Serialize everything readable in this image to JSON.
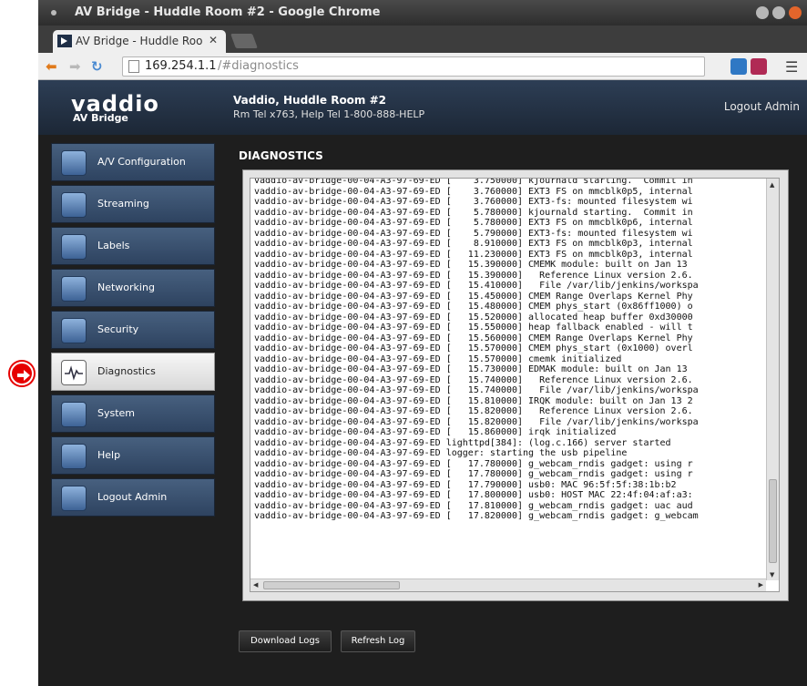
{
  "browser": {
    "window_title": "AV Bridge - Huddle Room #2 - Google Chrome",
    "tab_title": "AV Bridge - Huddle Roo",
    "url_host": "169.254.1.1",
    "url_path": "/#diagnostics"
  },
  "header": {
    "logo": "vaddio",
    "product": "AV Bridge",
    "room_title": "Vaddio, Huddle Room #2",
    "room_phones": "Rm Tel x763, Help Tel 1-800-888-HELP",
    "logout": "Logout Admin"
  },
  "sidebar": {
    "items": [
      {
        "label": "A/V Configuration",
        "icon": "av-config-icon",
        "active": false
      },
      {
        "label": "Streaming",
        "icon": "streaming-icon",
        "active": false
      },
      {
        "label": "Labels",
        "icon": "labels-icon",
        "active": false
      },
      {
        "label": "Networking",
        "icon": "networking-icon",
        "active": false
      },
      {
        "label": "Security",
        "icon": "security-icon",
        "active": false
      },
      {
        "label": "Diagnostics",
        "icon": "diagnostics-icon",
        "active": true
      },
      {
        "label": "System",
        "icon": "system-icon",
        "active": false
      },
      {
        "label": "Help",
        "icon": "help-icon",
        "active": false
      },
      {
        "label": "Logout Admin",
        "icon": "logout-icon",
        "active": false
      }
    ]
  },
  "main": {
    "title": "DIAGNOSTICS",
    "log_lines": [
      "vaddio-av-bridge-00-04-A3-97-69-ED [    3.750000] kjournald starting.  Commit in",
      "vaddio-av-bridge-00-04-A3-97-69-ED [    3.760000] EXT3 FS on mmcblk0p5, internal",
      "vaddio-av-bridge-00-04-A3-97-69-ED [    3.760000] EXT3-fs: mounted filesystem wi",
      "vaddio-av-bridge-00-04-A3-97-69-ED [    5.780000] kjournald starting.  Commit in",
      "vaddio-av-bridge-00-04-A3-97-69-ED [    5.780000] EXT3 FS on mmcblk0p6, internal",
      "vaddio-av-bridge-00-04-A3-97-69-ED [    5.790000] EXT3-fs: mounted filesystem wi",
      "vaddio-av-bridge-00-04-A3-97-69-ED [    8.910000] EXT3 FS on mmcblk0p3, internal",
      "vaddio-av-bridge-00-04-A3-97-69-ED [   11.230000] EXT3 FS on mmcblk0p3, internal",
      "vaddio-av-bridge-00-04-A3-97-69-ED [   15.390000] CMEMK module: built on Jan 13",
      "vaddio-av-bridge-00-04-A3-97-69-ED [   15.390000]   Reference Linux version 2.6.",
      "vaddio-av-bridge-00-04-A3-97-69-ED [   15.410000]   File /var/lib/jenkins/workspa",
      "vaddio-av-bridge-00-04-A3-97-69-ED [   15.450000] CMEM Range Overlaps Kernel Phy",
      "vaddio-av-bridge-00-04-A3-97-69-ED [   15.480000] CMEM phys_start (0x86ff1000) o",
      "vaddio-av-bridge-00-04-A3-97-69-ED [   15.520000] allocated heap buffer 0xd30000",
      "vaddio-av-bridge-00-04-A3-97-69-ED [   15.550000] heap fallback enabled - will t",
      "vaddio-av-bridge-00-04-A3-97-69-ED [   15.560000] CMEM Range Overlaps Kernel Phy",
      "vaddio-av-bridge-00-04-A3-97-69-ED [   15.570000] CMEM phys_start (0x1000) overl",
      "vaddio-av-bridge-00-04-A3-97-69-ED [   15.570000] cmemk initialized",
      "vaddio-av-bridge-00-04-A3-97-69-ED [   15.730000] EDMAK module: built on Jan 13",
      "vaddio-av-bridge-00-04-A3-97-69-ED [   15.740000]   Reference Linux version 2.6.",
      "vaddio-av-bridge-00-04-A3-97-69-ED [   15.740000]   File /var/lib/jenkins/workspa",
      "vaddio-av-bridge-00-04-A3-97-69-ED [   15.810000] IRQK module: built on Jan 13 2",
      "vaddio-av-bridge-00-04-A3-97-69-ED [   15.820000]   Reference Linux version 2.6.",
      "vaddio-av-bridge-00-04-A3-97-69-ED [   15.820000]   File /var/lib/jenkins/workspa",
      "vaddio-av-bridge-00-04-A3-97-69-ED [   15.860000] irqk initialized",
      "vaddio-av-bridge-00-04-A3-97-69-ED lighttpd[384]: (log.c.166) server started",
      "vaddio-av-bridge-00-04-A3-97-69-ED logger: starting the usb pipeline",
      "vaddio-av-bridge-00-04-A3-97-69-ED [   17.780000] g_webcam_rndis gadget: using r",
      "vaddio-av-bridge-00-04-A3-97-69-ED [   17.780000] g_webcam_rndis gadget: using r",
      "vaddio-av-bridge-00-04-A3-97-69-ED [   17.790000] usb0: MAC 96:5f:5f:38:1b:b2",
      "vaddio-av-bridge-00-04-A3-97-69-ED [   17.800000] usb0: HOST MAC 22:4f:04:af:a3:",
      "vaddio-av-bridge-00-04-A3-97-69-ED [   17.810000] g_webcam_rndis gadget: uac aud",
      "vaddio-av-bridge-00-04-A3-97-69-ED [   17.820000] g_webcam_rndis gadget: g_webcam",
      "",
      "",
      "",
      ""
    ],
    "download_button": "Download Logs",
    "refresh_button": "Refresh Log"
  },
  "colors": {
    "callout": "#e60000",
    "nav_blue": "#3b5272",
    "header_blue": "#243348"
  }
}
